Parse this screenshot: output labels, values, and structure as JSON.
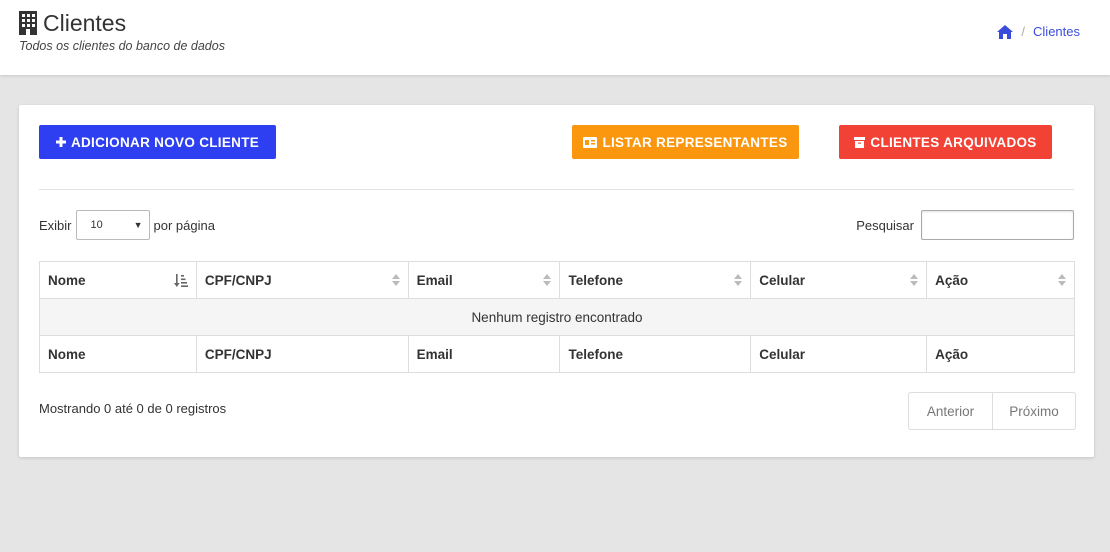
{
  "header": {
    "title": "Clientes",
    "subtitle": "Todos os clientes do banco de dados",
    "title_icon": "building-icon"
  },
  "breadcrumb": {
    "home_icon": "home-icon",
    "current": "Clientes"
  },
  "actions": {
    "add_label": "ADICIONAR NOVO CLIENTE",
    "list_label": "LISTAR REPRESENTANTES",
    "archived_label": "CLIENTES ARQUIVADOS"
  },
  "colors": {
    "add": "#2d3ff0",
    "list": "#fb960f",
    "archived": "#f14235",
    "link": "#3a4cdb"
  },
  "table_controls": {
    "show_label": "Exibir",
    "page_size": "10",
    "per_page_label": "por página",
    "search_label": "Pesquisar",
    "search_value": ""
  },
  "table": {
    "columns": [
      "Nome",
      "CPF/CNPJ",
      "Email",
      "Telefone",
      "Celular",
      "Ação"
    ],
    "empty_message": "Nenhum registro encontrado",
    "sorted_column": "Nome"
  },
  "footer": {
    "info": "Mostrando 0 até 0 de 0 registros",
    "prev_label": "Anterior",
    "next_label": "Próximo"
  }
}
